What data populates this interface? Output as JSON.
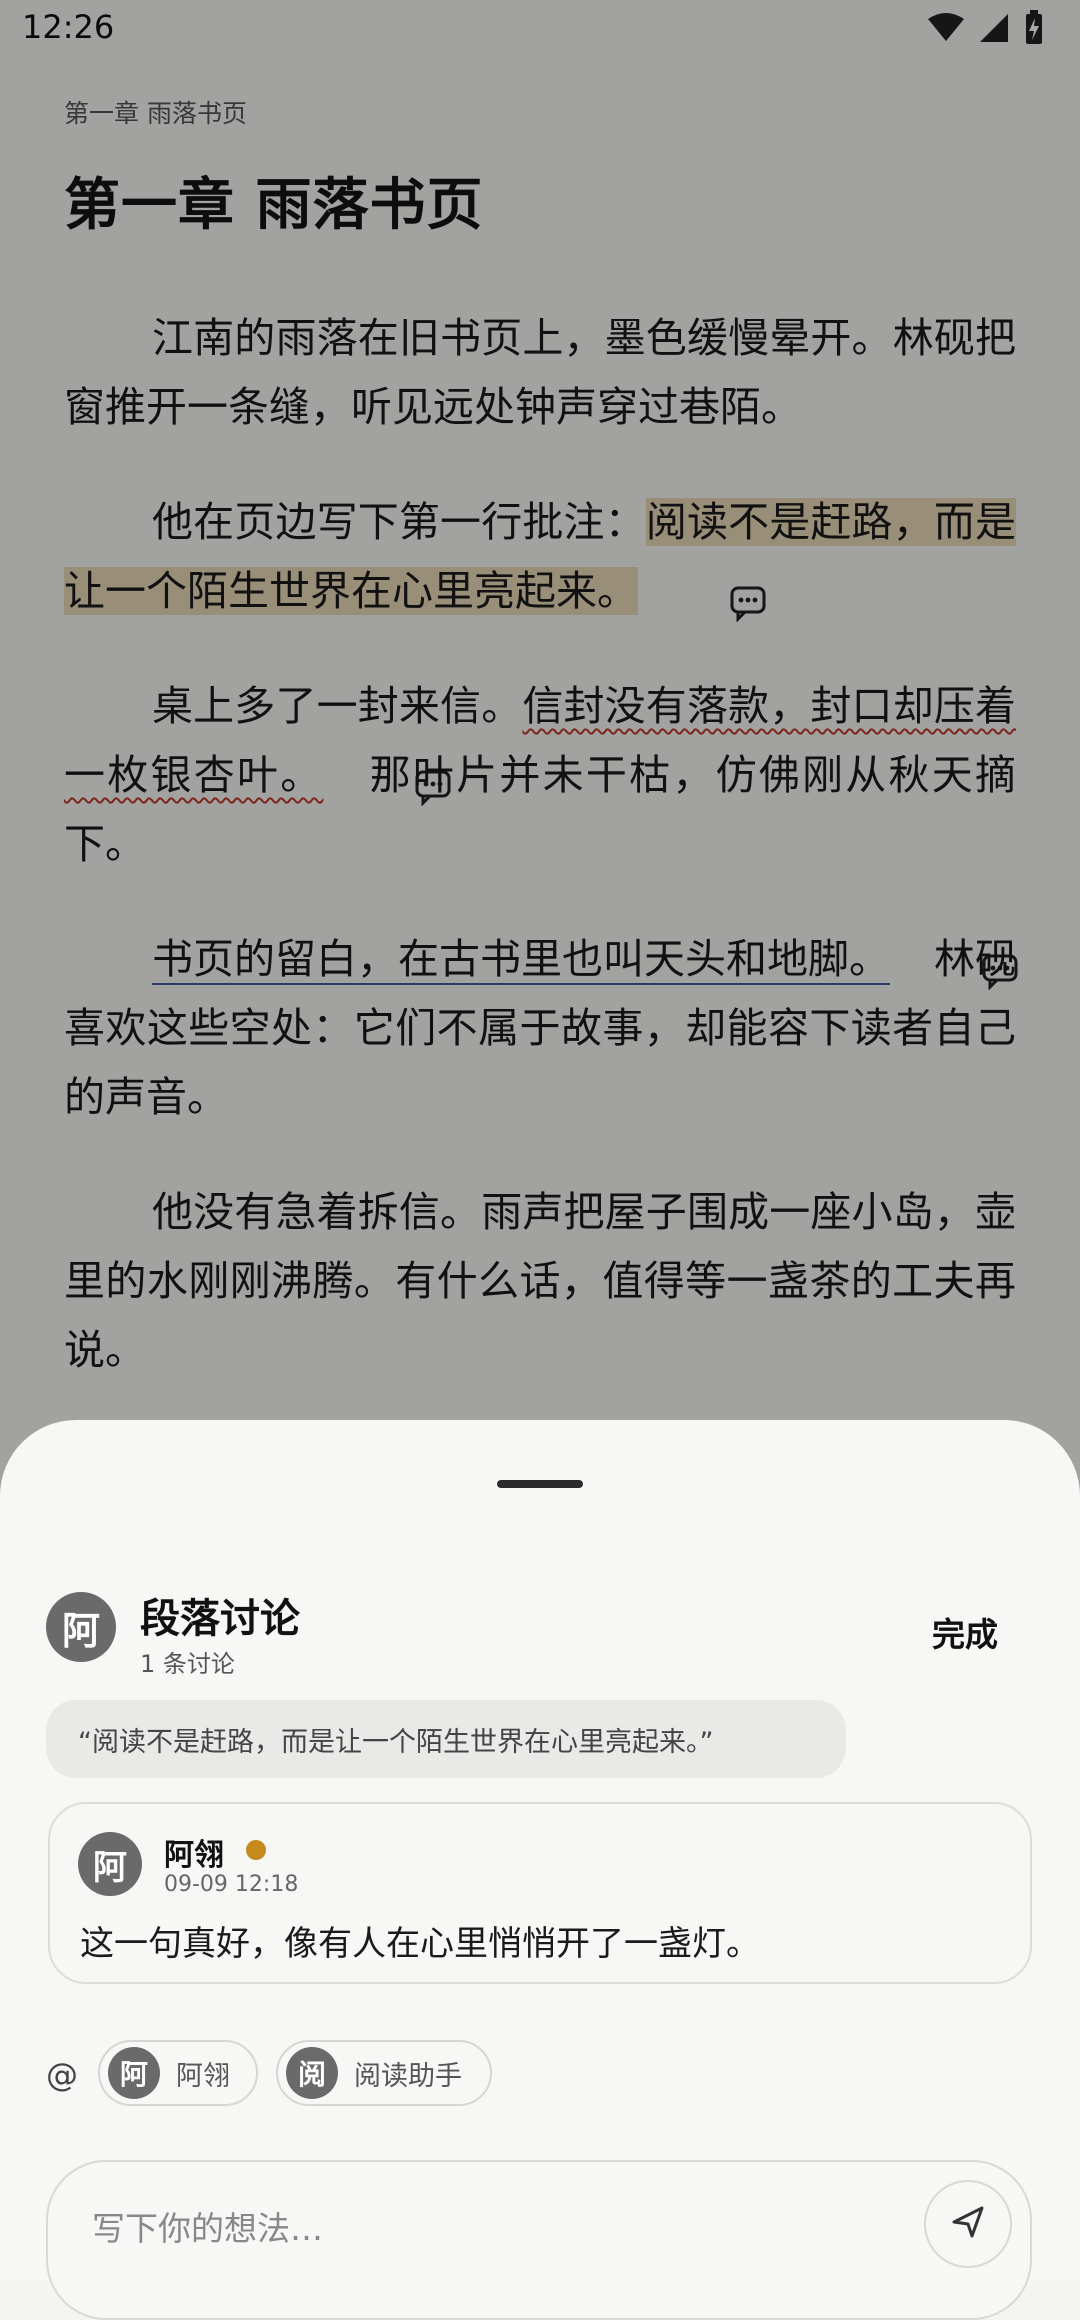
{
  "status": {
    "time": "12:26"
  },
  "reader": {
    "chapter_small": "第一章 雨落书页",
    "chapter_title": "第一章 雨落书页",
    "p1": "江南的雨落在旧书页上，墨色缓慢晕开。林砚把窗推开一条缝，听见远处钟声穿过巷陌。",
    "p2_a": "他在页边写下第一行批注：",
    "p2_hl": "阅读不是赶路，而是让一个陌生世界在心里亮起来。",
    "p3_a": "桌上多了一封来信。",
    "p3_squig": "信封没有落款，封口却压着一枚银杏叶。",
    "p3_b": "那叶片并未干枯，仿佛刚从秋天摘下。",
    "p4_ul": "书页的留白，在古书里也叫天头和地脚。",
    "p4_b": "林砚喜欢这些空处：它们不属于故事，却能容下读者自己的声音。",
    "p5": "他没有急着拆信。雨声把屋子围成一座小岛，壶里的水刚刚沸腾。有什么话，值得等一盏茶的工夫再说。"
  },
  "sheet": {
    "avatar_char": "阿",
    "title": "段落讨论",
    "subtitle": "1 条讨论",
    "done_label": "完成",
    "quote": "“阅读不是赶路，而是让一个陌生世界在心里亮起来。”",
    "comment": {
      "avatar_char": "阿",
      "author": "阿翎",
      "time": "09-09 12:18",
      "text": "这一句真好，像有人在心里悄悄开了一盏灯。",
      "dot_color": "#c58a1b"
    },
    "mention_symbol": "@",
    "mentions": [
      {
        "avatar_char": "阿",
        "label": "阿翎"
      },
      {
        "avatar_char": "阅",
        "label": "阅读助手"
      }
    ],
    "input_placeholder": "写下你的想法…"
  }
}
